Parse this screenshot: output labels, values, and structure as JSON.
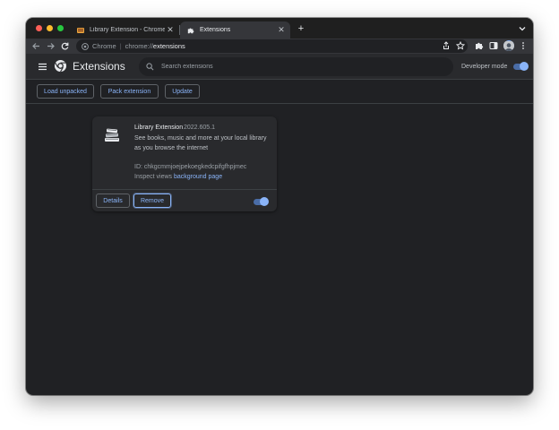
{
  "tabs": [
    {
      "title": "Library Extension - Chrome Web",
      "close": "✕"
    },
    {
      "title": "Extensions",
      "close": "✕"
    }
  ],
  "new_tab": "+",
  "omnibox": {
    "site_name": "Chrome",
    "separator": "|",
    "scheme": "chrome://",
    "host": "extensions"
  },
  "header": {
    "title": "Extensions",
    "search_placeholder": "Search extensions",
    "developer_mode_label": "Developer mode",
    "developer_mode_on": true
  },
  "actions": {
    "load_unpacked": "Load unpacked",
    "pack_extension": "Pack extension",
    "update": "Update"
  },
  "extension": {
    "name": "Library Extension",
    "version": "2022.605.1",
    "description": "See books, music and more at your local library as you browse the internet",
    "id_text": "ID: chkgcmmjoejpekoegkedcpifgfhpjmec",
    "inspect_label": "Inspect views",
    "inspect_link": "background page",
    "details_label": "Details",
    "remove_label": "Remove",
    "enabled": true
  },
  "colors": {
    "accent": "#8ab4f8",
    "background": "#202124",
    "surface": "#292a2d"
  }
}
